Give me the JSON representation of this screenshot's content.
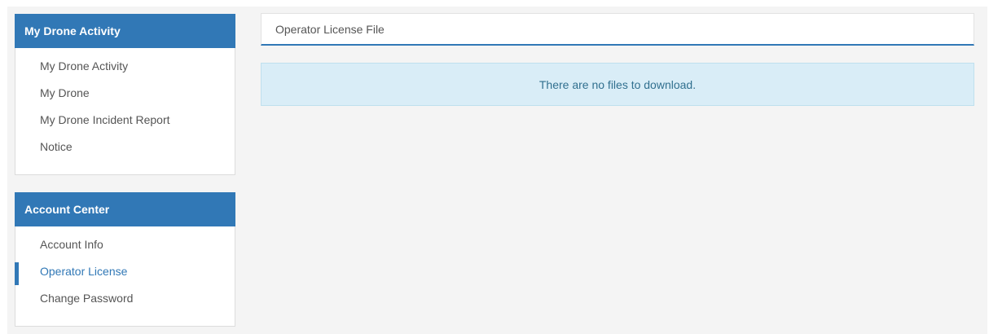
{
  "sidebar": {
    "activity": {
      "title": "My Drone Activity",
      "items": [
        {
          "label": "My Drone Activity"
        },
        {
          "label": "My Drone"
        },
        {
          "label": "My Drone Incident Report"
        },
        {
          "label": "Notice"
        }
      ]
    },
    "account": {
      "title": "Account Center",
      "items": [
        {
          "label": "Account Info"
        },
        {
          "label": "Operator License"
        },
        {
          "label": "Change Password"
        }
      ]
    }
  },
  "main": {
    "section_title": "Operator License File",
    "empty_message": "There are no files to download."
  },
  "colors": {
    "accent": "#3178b6",
    "alert_bg": "#d9edf7",
    "alert_text": "#31708f"
  }
}
